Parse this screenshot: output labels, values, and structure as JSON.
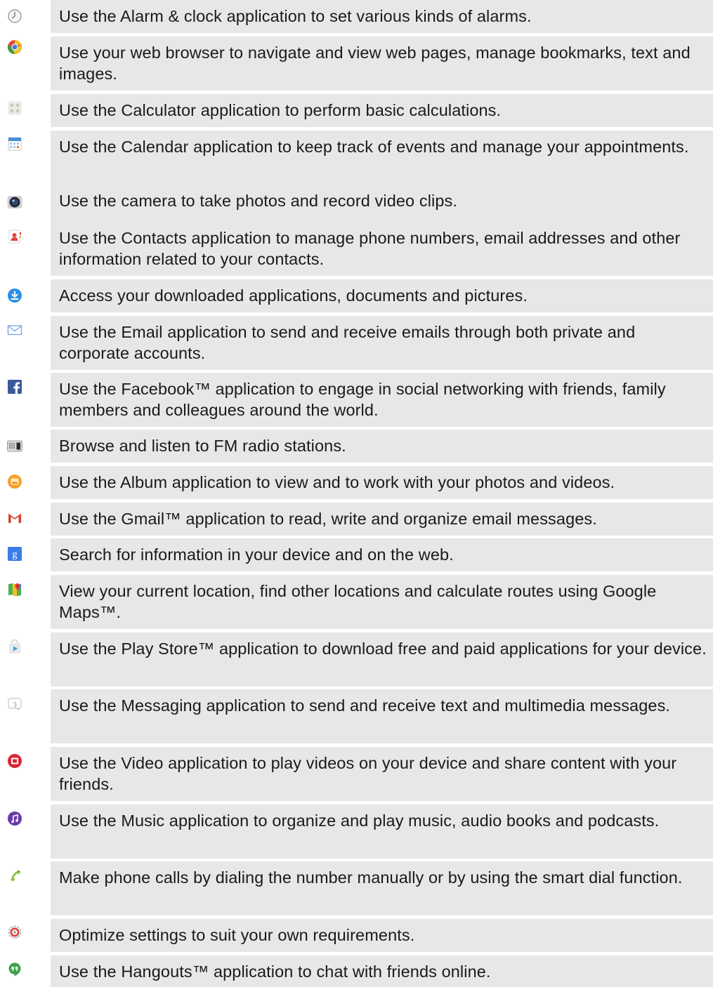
{
  "apps": [
    {
      "icon": "alarm-clock-icon",
      "text": "Use the Alarm & clock application to set various kinds of alarms."
    },
    {
      "icon": "web-browser-icon",
      "text": "Use your web browser to navigate and view web pages, manage bookmarks, text and images."
    },
    {
      "icon": "calculator-icon",
      "text": "Use the Calculator application to perform basic calculations."
    },
    {
      "icon": "calendar-icon",
      "text": "Use the Calendar application to keep track of events and manage your appointments."
    },
    {
      "icon": "camera-icon",
      "text": "Use the camera to take photos and record video clips."
    },
    {
      "icon": "contacts-icon",
      "text": "Use the Contacts application to manage phone numbers, email addresses and other information related to your contacts."
    },
    {
      "icon": "downloads-icon",
      "text": "Access your downloaded applications, documents and pictures."
    },
    {
      "icon": "email-icon",
      "text": "Use the Email application to send and receive emails through both private and corporate accounts."
    },
    {
      "icon": "facebook-icon",
      "text": "Use the Facebook™ application to engage in social networking with friends, family members and colleagues around the world."
    },
    {
      "icon": "fm-radio-icon",
      "text": "Browse and listen to FM radio stations."
    },
    {
      "icon": "album-icon",
      "text": "Use the Album application to view and to work with your photos and videos."
    },
    {
      "icon": "gmail-icon",
      "text": "Use the Gmail™ application to read, write and organize email messages."
    },
    {
      "icon": "google-search-icon",
      "text": "Search for information in your device and on the web."
    },
    {
      "icon": "google-maps-icon",
      "text": "View your current location, find other locations and calculate routes using Google Maps™."
    },
    {
      "icon": "play-store-icon",
      "text": "Use the Play Store™ application to download free and paid applications for your device."
    },
    {
      "icon": "messaging-icon",
      "text": "Use the Messaging application to send and receive text and multimedia messages."
    },
    {
      "icon": "video-icon",
      "text": "Use the Video application to play videos on your device and share content with your friends."
    },
    {
      "icon": "music-icon",
      "text": "Use the Music application to organize and play music, audio books and podcasts."
    },
    {
      "icon": "phone-icon",
      "text": "Make phone calls by dialing the number manually or by using the smart dial function."
    },
    {
      "icon": "settings-icon",
      "text": "Optimize settings to suit your own requirements."
    },
    {
      "icon": "hangouts-icon",
      "text": "Use the Hangouts™ application to chat with friends online."
    }
  ]
}
